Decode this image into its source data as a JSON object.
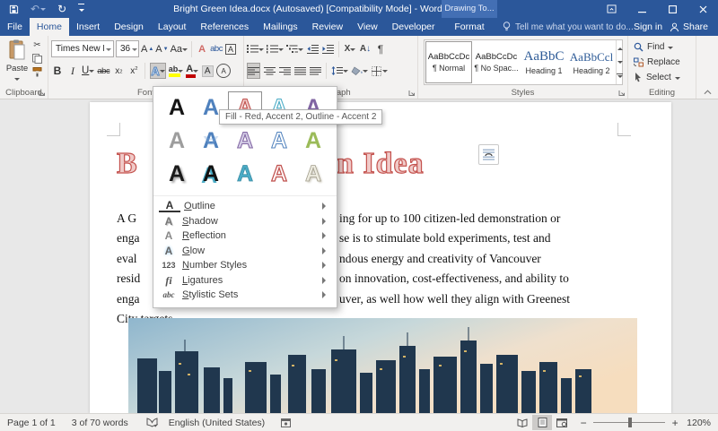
{
  "titlebar": {
    "title": "Bright Green Idea.docx (Autosaved) [Compatibility Mode] - Word",
    "context_label": "Drawing To..."
  },
  "qat": {
    "undo": "↶",
    "redo": "↻"
  },
  "tabs": [
    {
      "label": "File",
      "cls": "t-file"
    },
    {
      "label": "Home",
      "cls": "t-active"
    },
    {
      "label": "Insert",
      "cls": ""
    },
    {
      "label": "Design",
      "cls": ""
    },
    {
      "label": "Layout",
      "cls": ""
    },
    {
      "label": "References",
      "cls": ""
    },
    {
      "label": "Mailings",
      "cls": ""
    },
    {
      "label": "Review",
      "cls": ""
    },
    {
      "label": "View",
      "cls": ""
    },
    {
      "label": "Developer",
      "cls": ""
    }
  ],
  "context_tab": "Format",
  "tellme": "Tell me what you want to do...",
  "account": {
    "sign_in": "Sign in",
    "share": "Share"
  },
  "ribbon": {
    "clipboard": {
      "label": "Clipboard",
      "paste": "Paste",
      "cut": "✂"
    },
    "font": {
      "label": "Font",
      "name": "Times New Ro",
      "size": "36",
      "grow": "A",
      "shrink": "A",
      "case": "Aa",
      "phonetic": "A",
      "char_border": "A",
      "bold": "B",
      "italic": "I",
      "underline": "U",
      "strike": "abc",
      "sub_base": "x",
      "sub": "2",
      "sup_base": "x",
      "sup": "2",
      "effects": "A",
      "highlight": "ab",
      "font_color": "A",
      "shading": "A",
      "enclose": "A"
    },
    "paragraph": {
      "label": "Paragraph",
      "sort": "A",
      "arrow_down": "↓",
      "asian": "X",
      "pilcrow": "¶"
    },
    "styles": {
      "label": "Styles",
      "cards": [
        {
          "preview": "AaBbCcDc",
          "name": "¶ Normal",
          "pcls": "pv-body",
          "ccls": "sel"
        },
        {
          "preview": "AaBbCcDc",
          "name": "¶ No Spac...",
          "pcls": "pv-body",
          "ccls": ""
        },
        {
          "preview": "AaBbC",
          "name": "Heading 1",
          "pcls": "pv-h1",
          "ccls": ""
        },
        {
          "preview": "AaBbCcl",
          "name": "Heading 2",
          "pcls": "pv-h2",
          "ccls": ""
        }
      ]
    },
    "editing": {
      "label": "Editing",
      "find": "Find",
      "replace": "Replace",
      "select": "Select"
    }
  },
  "fx_menu": {
    "tooltip": "Fill - Red, Accent 2, Outline - Accent 2",
    "cells": [
      {
        "g": "A",
        "cls": "fx-black"
      },
      {
        "g": "A",
        "cls": "fx-blue"
      },
      {
        "g": "A",
        "cls": "fx-red-soft sel-cell"
      },
      {
        "g": "A",
        "cls": "fx-cyan-o"
      },
      {
        "g": "A",
        "cls": "fx-purple"
      },
      {
        "g": "A",
        "cls": "fx-gray"
      },
      {
        "g": "A",
        "cls": "fx-blue-refl"
      },
      {
        "g": "A",
        "cls": "fx-purple-o"
      },
      {
        "g": "A",
        "cls": "fx-blue-o"
      },
      {
        "g": "A",
        "cls": "fx-green"
      },
      {
        "g": "A",
        "cls": "fx-black-sh"
      },
      {
        "g": "A",
        "cls": "fx-black-cy"
      },
      {
        "g": "A",
        "cls": "fx-cyan"
      },
      {
        "g": "A",
        "cls": "fx-red-o"
      },
      {
        "g": "A",
        "cls": "fx-ivory"
      }
    ],
    "items": [
      {
        "label": "Outline",
        "glyph": "A",
        "ic": "ic-outline"
      },
      {
        "label": "Shadow",
        "glyph": "A",
        "ic": "ic-shadow"
      },
      {
        "label": "Reflection",
        "glyph": "A",
        "ic": "ic-reflection"
      },
      {
        "label": "Glow",
        "glyph": "A",
        "ic": "ic-glow"
      },
      {
        "label": "Number Styles",
        "glyph": "123",
        "ic": "ic-number"
      },
      {
        "label": "Ligatures",
        "glyph": "fi",
        "ic": "ic-lig"
      },
      {
        "label": "Stylistic Sets",
        "glyph": "abc",
        "ic": "ic-styl"
      }
    ]
  },
  "document": {
    "title_left": "B",
    "title_right": "n Idea",
    "body": [
      {
        "l": "A G",
        "r": "ing for up to 100 citizen-led demonstration or"
      },
      {
        "l": "enga",
        "r": "se is to stimulate bold experiments, test and"
      },
      {
        "l": "eval",
        "r": "ndous energy and creativity of Vancouver"
      },
      {
        "l": "resid",
        "r": "on innovation, cost-effectiveness, and ability to"
      },
      {
        "l": "enga",
        "r": "uver, as well how well they align with Greenest"
      },
      {
        "l": "City targets.",
        "r": ""
      }
    ]
  },
  "statusbar": {
    "page": "Page 1 of 1",
    "words": "3 of 70 words",
    "language": "English (United States)",
    "zoom": "120%",
    "minus": "−",
    "plus": "+"
  },
  "colors": {
    "titlebar": "#2b579a",
    "accent_red": "#c0504d",
    "accent_blue": "#4f81bd",
    "accent_cyan": "#4bacc6",
    "accent_purple": "#8064a2",
    "accent_green": "#9bbb59",
    "highlight_yellow": "#ffff00",
    "font_color_red": "#c00000"
  }
}
